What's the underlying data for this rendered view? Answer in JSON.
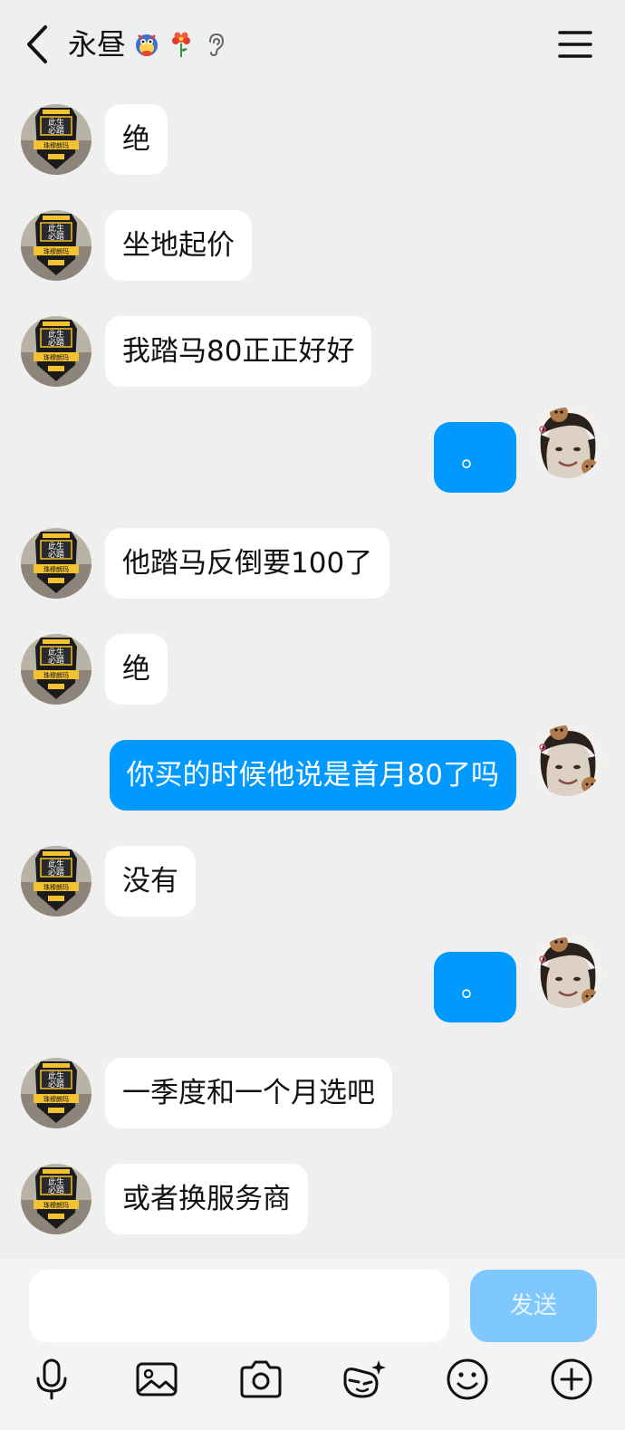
{
  "header": {
    "title": "永昼",
    "badges": [
      "qq-mascot-badge",
      "flower-badge",
      "ear-icon"
    ]
  },
  "messages": [
    {
      "side": "other",
      "text": "绝"
    },
    {
      "side": "other",
      "text": "坐地起价"
    },
    {
      "side": "other",
      "text": "我踏马80正正好好"
    },
    {
      "side": "me",
      "text": "。"
    },
    {
      "side": "other",
      "text": "他踏马反倒要100了"
    },
    {
      "side": "other",
      "text": "绝"
    },
    {
      "side": "me",
      "text": "你买的时候他说是首月80了吗"
    },
    {
      "side": "other",
      "text": "没有"
    },
    {
      "side": "me",
      "text": "。"
    },
    {
      "side": "other",
      "text": "一季度和一个月选吧"
    },
    {
      "side": "other",
      "text": "或者换服务商"
    }
  ],
  "input": {
    "value": "",
    "placeholder": "",
    "send_label": "发送"
  },
  "toolbar": [
    "microphone-icon",
    "image-icon",
    "camera-icon",
    "sticker-icon",
    "emoji-icon",
    "plus-icon"
  ],
  "colors": {
    "background": "#efefef",
    "self_bubble": "#0099ff",
    "other_bubble": "#ffffff",
    "send_disabled": "#7fc8ff"
  }
}
